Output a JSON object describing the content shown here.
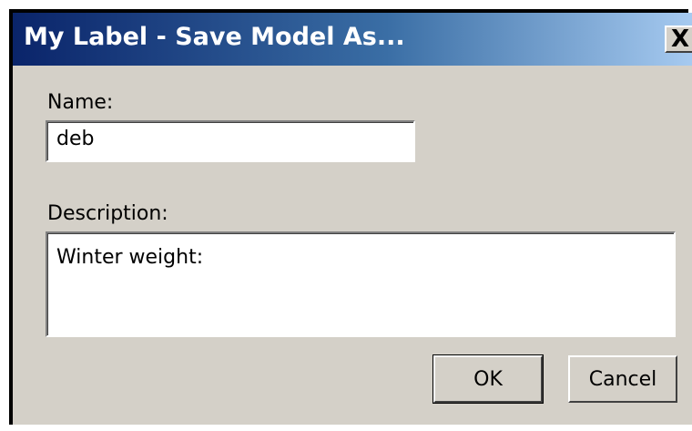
{
  "window": {
    "title": "My Label - Save Model As...",
    "close_label": "X"
  },
  "form": {
    "name_label": "Name:",
    "name_value": "deb",
    "description_label": "Description:",
    "description_value": "Winter weight:"
  },
  "buttons": {
    "ok_label": "OK",
    "cancel_label": "Cancel"
  },
  "colors": {
    "titlebar_start": "#0a246a",
    "titlebar_end": "#a6caf0",
    "dialog_background": "#d4d0c8"
  }
}
